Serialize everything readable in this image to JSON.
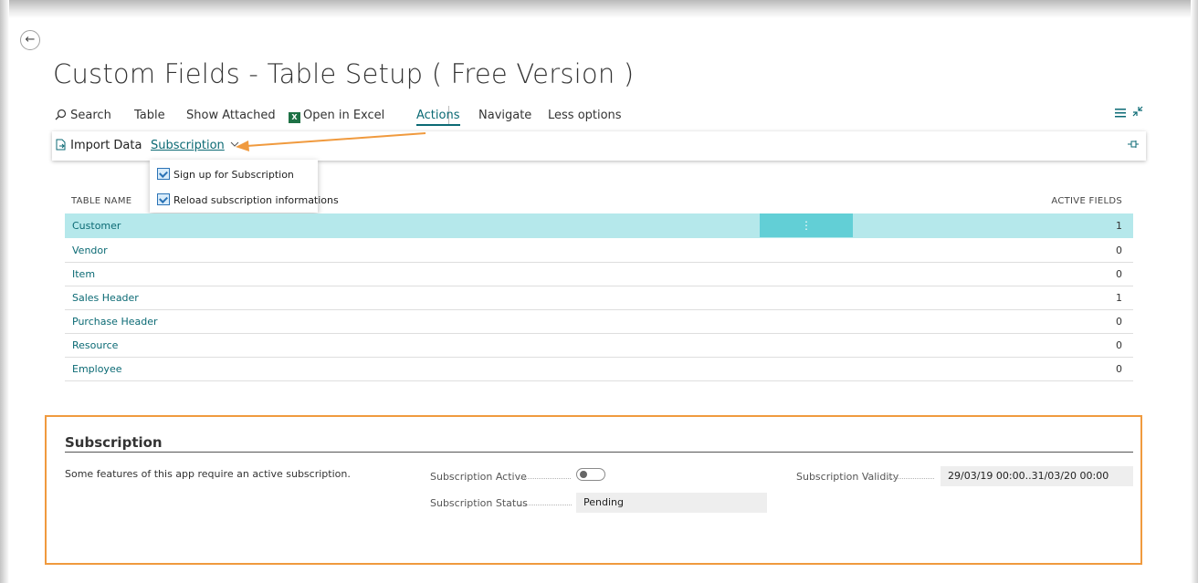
{
  "page": {
    "title": "Custom Fields - Table Setup ( Free Version )"
  },
  "action_bar": {
    "search": "Search",
    "table": "Table",
    "show_attached": "Show Attached",
    "open_in_excel": "Open in Excel",
    "actions": "Actions",
    "navigate": "Navigate",
    "less_options": "Less options"
  },
  "sub_bar": {
    "import_data": "Import Data",
    "subscription": "Subscription"
  },
  "dropdown": {
    "items": [
      {
        "label": "Sign up for Subscription"
      },
      {
        "label": "Reload subscription informations"
      }
    ]
  },
  "table": {
    "columns": {
      "name": "TABLE NAME",
      "active_fields": "ACTIVE FIELDS"
    },
    "rows": [
      {
        "name": "Customer",
        "active_fields": "1"
      },
      {
        "name": "Vendor",
        "active_fields": "0"
      },
      {
        "name": "Item",
        "active_fields": "0"
      },
      {
        "name": "Sales Header",
        "active_fields": "1"
      },
      {
        "name": "Purchase Header",
        "active_fields": "0"
      },
      {
        "name": "Resource",
        "active_fields": "0"
      },
      {
        "name": "Employee",
        "active_fields": "0"
      }
    ],
    "row_menu": "⋮"
  },
  "subscription": {
    "title": "Subscription",
    "description": "Some features of this app require an active subscription.",
    "active_label": "Subscription Active",
    "active_value": false,
    "status_label": "Subscription Status",
    "status_value": "Pending",
    "validity_label": "Subscription Validity",
    "validity_value": "29/03/19 00:00..31/03/20 00:00"
  },
  "colors": {
    "accent": "#0b6a74",
    "selected_row": "#b5e8eb",
    "annotation": "#f09a3e"
  }
}
